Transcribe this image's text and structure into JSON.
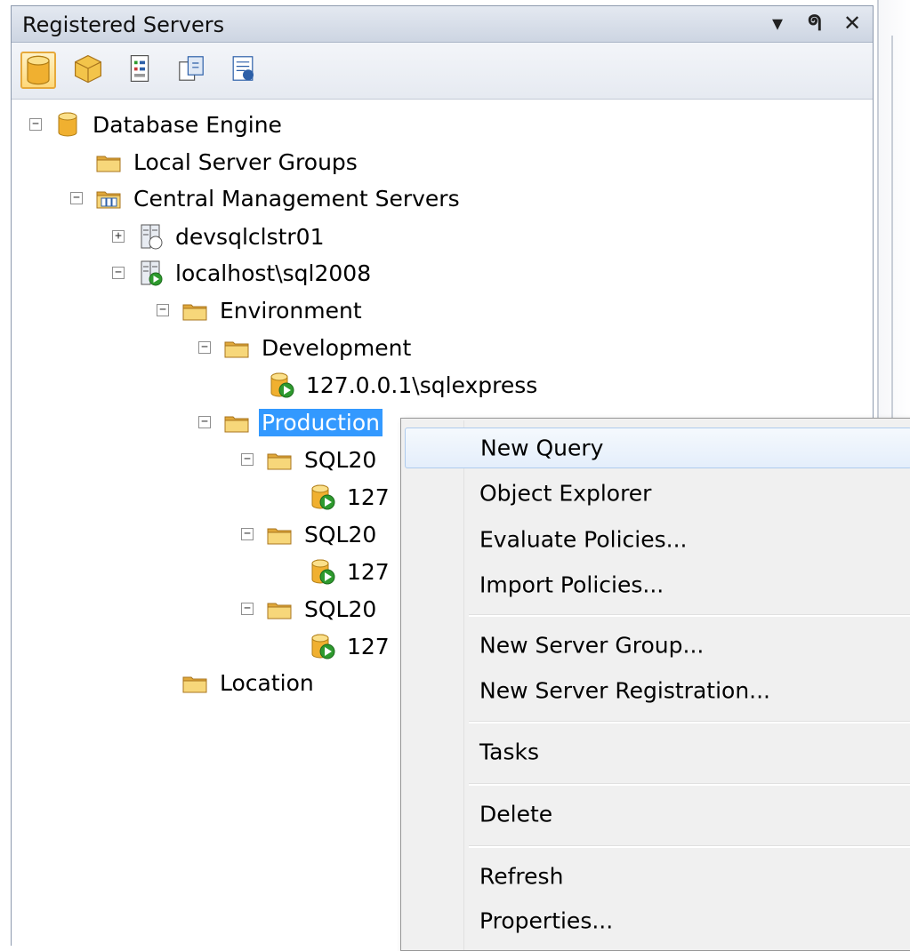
{
  "panel": {
    "title": "Registered Servers",
    "controls": {
      "dropdown": "▾",
      "pin": "ᖗ",
      "close": "✕"
    }
  },
  "toolbar": {
    "buttons": [
      "database-engine-icon",
      "analysis-services-icon",
      "reporting-services-icon",
      "integration-services-icon",
      "sql-compact-icon"
    ]
  },
  "tree": {
    "database_engine": "Database Engine",
    "local_server_groups": "Local Server Groups",
    "central_management_servers": "Central Management Servers",
    "devsqlclstr01": "devsqlclstr01",
    "localhost_sql2008": "localhost\\sql2008",
    "environment": "Environment",
    "development": "Development",
    "dev_server": "127.0.0.1\\sqlexpress",
    "production": "Production",
    "sql_group_1": "SQL20",
    "sql_group_1_server": "127",
    "sql_group_2": "SQL20",
    "sql_group_2_server": "127",
    "sql_group_3": "SQL20",
    "sql_group_3_server": "127",
    "location": "Location"
  },
  "context_menu": {
    "new_query": "New Query",
    "object_explorer": "Object Explorer",
    "evaluate_policies": "Evaluate Policies...",
    "import_policies": "Import Policies...",
    "new_server_group": "New Server Group...",
    "new_server_registration": "New Server Registration...",
    "tasks": "Tasks",
    "delete": "Delete",
    "refresh": "Refresh",
    "properties": "Properties..."
  },
  "colors": {
    "selection": "#3399ff",
    "folder": "#f2c14e",
    "database": "#f0b030",
    "running_badge": "#2e9a2e"
  }
}
